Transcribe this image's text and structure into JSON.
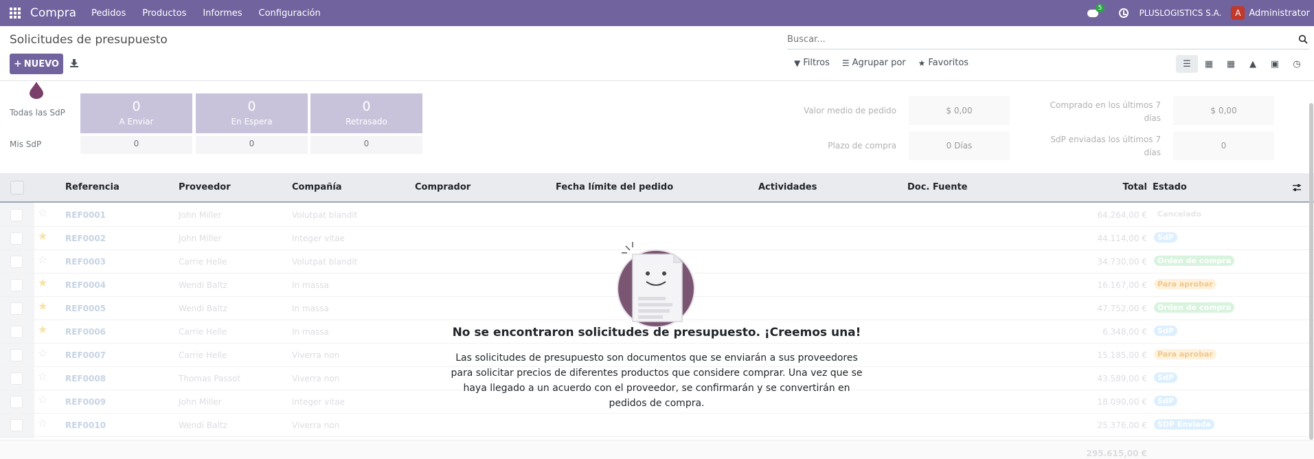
{
  "navbar": {
    "app_name": "Compra",
    "menu": [
      "Pedidos",
      "Productos",
      "Informes",
      "Configuración"
    ],
    "messages_badge": "5",
    "company": "PLUSLOGISTICS S.A.",
    "avatar_letter": "A",
    "username": "Administrator"
  },
  "control_panel": {
    "title": "Solicitudes de presupuesto",
    "new_button": "NUEVO",
    "search_placeholder": "Buscar...",
    "filters": "Filtros",
    "group_by": "Agrupar por",
    "favorites": "Favoritos"
  },
  "dashboard": {
    "all_label": "Todas las SdP",
    "mine_label": "Mis SdP",
    "tiles": [
      {
        "value": "0",
        "label": "A Enviar",
        "mine": "0"
      },
      {
        "value": "0",
        "label": "En Espera",
        "mine": "0"
      },
      {
        "value": "0",
        "label": "Retrasado",
        "mine": "0"
      }
    ],
    "kpis": {
      "avg_order_label": "Valor medio de pedido",
      "avg_order_value": "$ 0,00",
      "lead_time_label": "Plazo de compra",
      "lead_time_value": "0 Días",
      "purchased_label_1": "Comprado en los últimos 7",
      "purchased_label_2": "días",
      "purchased_value": "$ 0,00",
      "sent_label_1": "SdP enviadas los últimos 7",
      "sent_label_2": "días",
      "sent_value": "0"
    }
  },
  "table": {
    "headers": {
      "reference": "Referencia",
      "vendor": "Proveedor",
      "company": "Compañía",
      "buyer": "Comprador",
      "deadline": "Fecha límite del pedido",
      "activities": "Actividades",
      "source": "Doc. Fuente",
      "total": "Total",
      "status": "Estado"
    },
    "rows": [
      {
        "ref": "REF0001",
        "vendor": "John Miller",
        "company": "Volutpat blandit",
        "total": "64.264,00 €",
        "status": "Cancelado",
        "starred": false
      },
      {
        "ref": "REF0002",
        "vendor": "John Miller",
        "company": "Integer vitae",
        "total": "44.114,00 €",
        "status": "SdP",
        "starred": true
      },
      {
        "ref": "REF0003",
        "vendor": "Carrie Helle",
        "company": "Volutpat blandit",
        "total": "34.730,00 €",
        "status": "Orden de compra",
        "starred": false
      },
      {
        "ref": "REF0004",
        "vendor": "Wendi Baltz",
        "company": "In massa",
        "total": "16.167,00 €",
        "status": "Para aprobar",
        "starred": true
      },
      {
        "ref": "REF0005",
        "vendor": "Wendi Baltz",
        "company": "In massa",
        "total": "47.752,00 €",
        "status": "Orden de compra",
        "starred": true
      },
      {
        "ref": "REF0006",
        "vendor": "Carrie Helle",
        "company": "In massa",
        "total": "6.348,00 €",
        "status": "SdP",
        "starred": true
      },
      {
        "ref": "REF0007",
        "vendor": "Carrie Helle",
        "company": "Viverra non",
        "total": "15.185,00 €",
        "status": "Para aprobar",
        "starred": false
      },
      {
        "ref": "REF0008",
        "vendor": "Thomas Passot",
        "company": "Viverra non",
        "total": "43.589,00 €",
        "status": "SdP",
        "starred": false
      },
      {
        "ref": "REF0009",
        "vendor": "John Miller",
        "company": "Integer vitae",
        "total": "18.090,00 €",
        "status": "SdP",
        "starred": false
      },
      {
        "ref": "REF0010",
        "vendor": "Wendi Baltz",
        "company": "Viverra non",
        "total": "25.376,00 €",
        "status": "SDP Enviada",
        "starred": false
      }
    ],
    "footer_total": "295.615,00 €"
  },
  "empty_state": {
    "title": "No se encontraron solicitudes de presupuesto. ¡Creemos una!",
    "text": "Las solicitudes de presupuesto son documentos que se enviarán a sus proveedores para solicitar precios de diferentes productos que considere comprar. Una vez que se haya llegado a un acuerdo con el proveedor, se confirmarán y se convertirán en pedidos de compra."
  },
  "colors": {
    "brand": "#71639e",
    "tile": "#c8c3db",
    "success_badge": "#28a745"
  },
  "icons": [
    "apps-icon",
    "chat-icon",
    "clock-icon",
    "download-icon",
    "search-icon",
    "filter-icon",
    "layers-icon",
    "star-icon",
    "list-view-icon",
    "kanban-view-icon",
    "pivot-view-icon",
    "graph-view-icon",
    "calendar-view-icon",
    "activity-view-icon",
    "optional-columns-icon"
  ]
}
